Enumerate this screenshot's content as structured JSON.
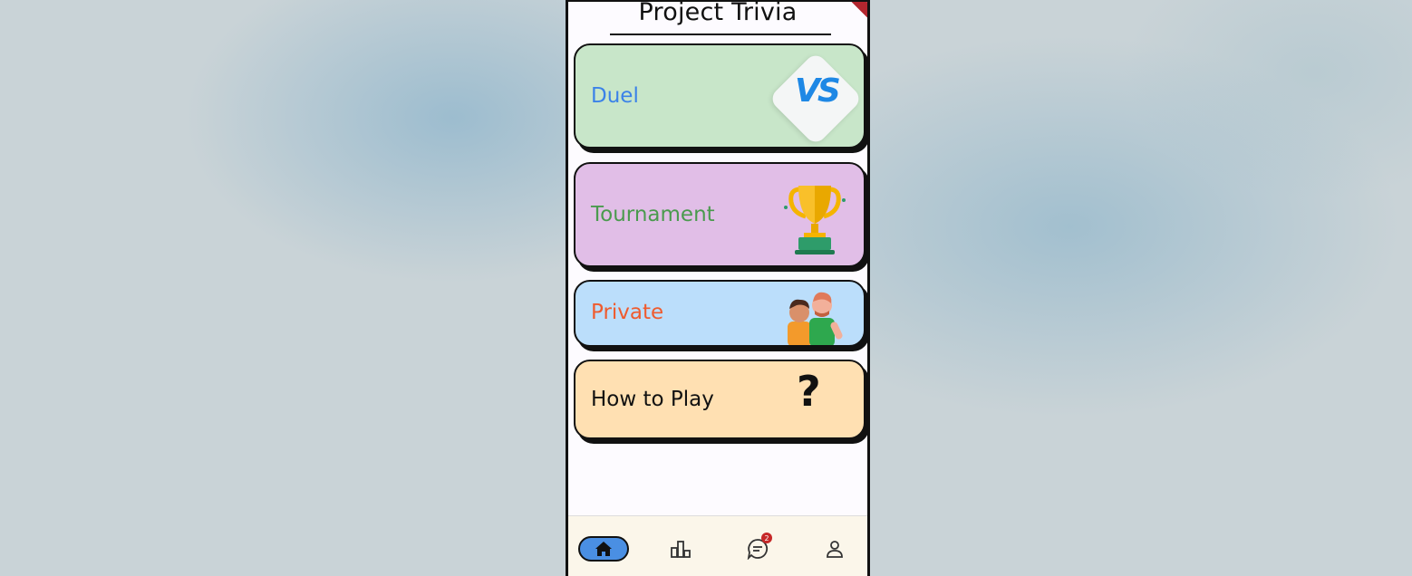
{
  "app": {
    "title": "Project Trivia"
  },
  "menu": {
    "duel": {
      "label": "Duel",
      "icon": "vs-icon",
      "icon_text": "VS"
    },
    "tournament": {
      "label": "Tournament",
      "icon": "trophy-icon"
    },
    "private": {
      "label": "Private",
      "icon": "two-friends-icon"
    },
    "how_to_play": {
      "label": "How to Play",
      "icon": "question-mark-icon",
      "icon_text": "?"
    }
  },
  "bottom_nav": {
    "items": [
      {
        "name": "home",
        "icon": "home-icon",
        "active": true
      },
      {
        "name": "leaderboard",
        "icon": "leaderboard-icon",
        "active": false
      },
      {
        "name": "chat",
        "icon": "chat-icon",
        "active": false,
        "badge": "2"
      },
      {
        "name": "profile",
        "icon": "profile-icon",
        "active": false
      }
    ]
  },
  "colors": {
    "duel_bg": "#c8e6c9",
    "tournament_bg": "#e1bee7",
    "private_bg": "#bbdefb",
    "how_bg": "#ffe0b2",
    "nav_active": "#4a8fe3"
  }
}
